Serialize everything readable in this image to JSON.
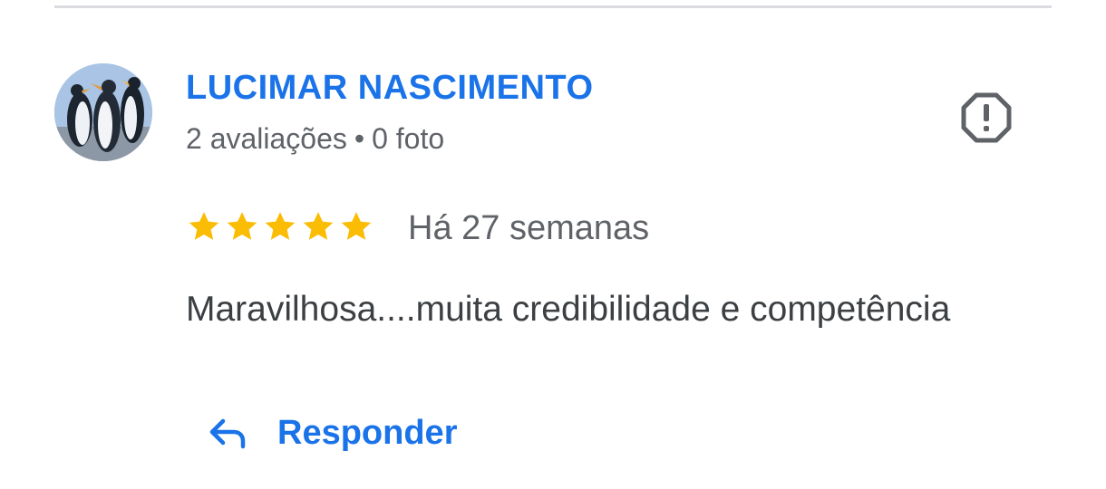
{
  "review": {
    "author_name": "LUCIMAR NASCIMENTO",
    "author_reviews": "2 avaliações",
    "separator": "•",
    "author_photos": "0 foto",
    "rating": 5,
    "rating_max": 5,
    "time_ago": "Há 27 semanas",
    "text": "Maravilhosa....muita credibilidade e competência",
    "avatar": "penguins-photo",
    "report_icon": "report-octagon-icon",
    "star_color": "#fbbc04"
  },
  "actions": {
    "reply_label": "Responder",
    "reply_icon": "reply-arrow-icon"
  },
  "colors": {
    "accent": "#1a73e8",
    "secondary_text": "#5f6368",
    "body_text": "#3c4043",
    "divider": "#dadce0"
  }
}
